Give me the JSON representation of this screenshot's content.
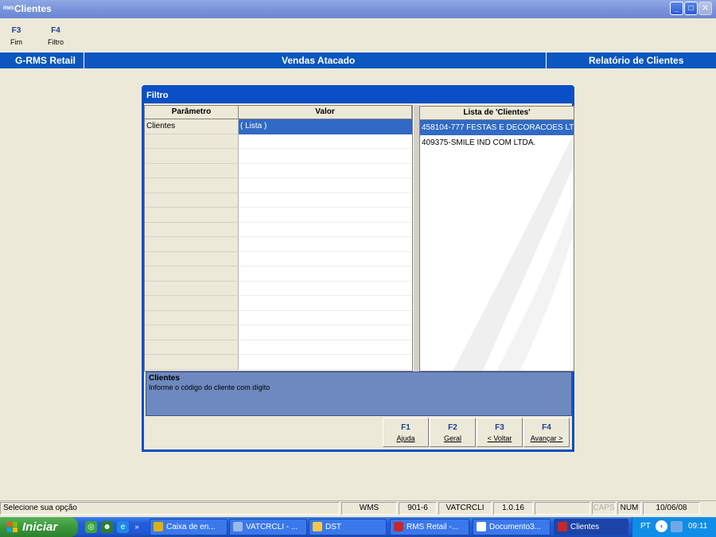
{
  "window": {
    "title": "Clientes",
    "icon_text": "RMS"
  },
  "fkeys": [
    {
      "key": "F3",
      "label": "Fim"
    },
    {
      "key": "F4",
      "label": "Filtro"
    }
  ],
  "band": {
    "left": "G-RMS Retail",
    "center": "Vendas Atacado",
    "right": "Relatório de Clientes"
  },
  "dialog": {
    "title": "Filtro",
    "grid": {
      "col_param": "Parâmetro",
      "col_value": "Valor",
      "rows": [
        {
          "param": "Clientes",
          "value": "( Lista )"
        }
      ]
    },
    "list": {
      "header": "Lista de 'Clientes'",
      "items": [
        "458104-777 FESTAS E DECORACOES LT",
        "409375-SMILE IND COM LTDA."
      ]
    },
    "help": {
      "title": "Clientes",
      "text": "Informe o código do cliente com dígito"
    },
    "buttons": [
      {
        "key": "F1",
        "label": "Ajuda"
      },
      {
        "key": "F2",
        "label": "Geral"
      },
      {
        "key": "F3",
        "label": "< Voltar"
      },
      {
        "key": "F4",
        "label": "Avançar >"
      }
    ]
  },
  "status": {
    "message": "Selecione sua opção",
    "wms": "WMS",
    "code": "901-6",
    "program": "VATCRCLI",
    "version": "1.0.16",
    "caps": "CAPS",
    "num": "NUM",
    "date": "10/06/08"
  },
  "taskbar": {
    "start": "Iniciar",
    "tasks": [
      "Caixa de en...",
      "VATCRCLI - ...",
      "DST",
      "RMS Retail -...",
      "Documento3...",
      "Clientes"
    ],
    "lang": "PT",
    "time": "09:11"
  },
  "colors": {
    "band": "#0B56C0",
    "dialog_frame": "#0A4FC5",
    "selection": "#316AC5",
    "help_bg": "#6D89C0"
  }
}
